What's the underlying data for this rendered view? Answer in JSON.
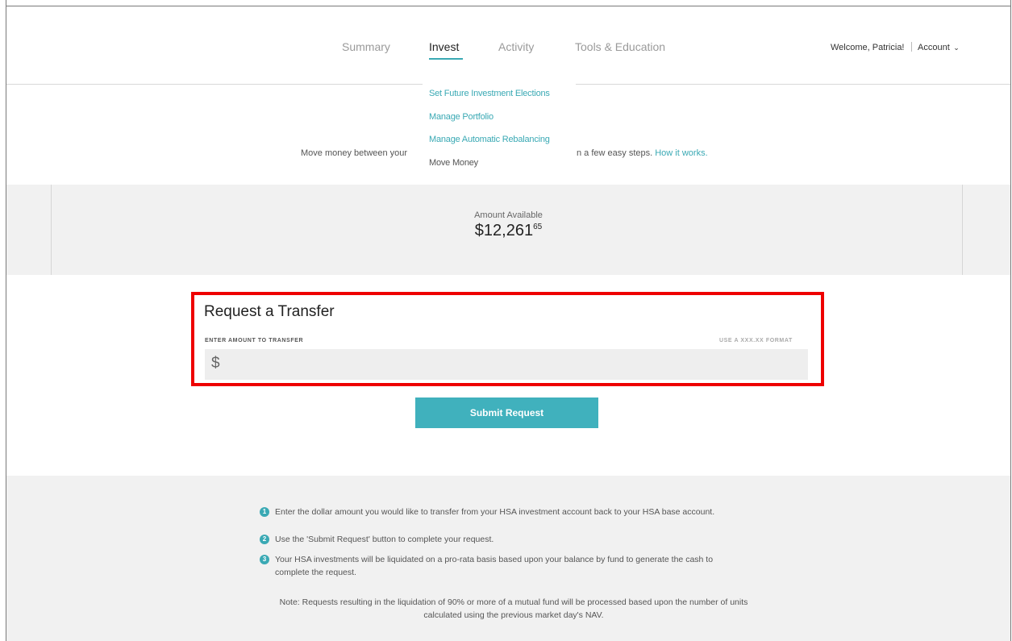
{
  "nav": {
    "items": [
      {
        "label": "Summary"
      },
      {
        "label": "Invest"
      },
      {
        "label": "Activity"
      },
      {
        "label": "Tools & Education"
      }
    ],
    "welcome": "Welcome, Patricia!",
    "account": "Account",
    "accent": "#3aa9b4"
  },
  "dropdown": {
    "items": [
      {
        "label": "Set Future Investment Elections"
      },
      {
        "label": "Manage Portfolio"
      },
      {
        "label": "Manage Automatic Rebalancing"
      },
      {
        "label": "Move Money"
      }
    ]
  },
  "intro": {
    "left": "Move money between your",
    "right": "n a few easy steps.",
    "link": "How it works."
  },
  "amount": {
    "label": "Amount Available",
    "dollars": "$12,261",
    "cents": "65"
  },
  "transfer": {
    "title": "Request a Transfer",
    "field_label": "ENTER AMOUNT TO TRANSFER",
    "format_hint": "USE A XXX.XX FORMAT",
    "currency": "$",
    "value": "",
    "placeholder": ""
  },
  "submit_label": "Submit Request",
  "steps": [
    {
      "num": "1",
      "text": "Enter the dollar amount you would like to transfer from your HSA investment account back to your HSA base account."
    },
    {
      "num": "2",
      "text": "Use the 'Submit Request' button to complete your request."
    },
    {
      "num": "3",
      "text": "Your HSA investments will be liquidated on a pro-rata basis based upon your balance by fund to generate the cash to complete the request."
    }
  ],
  "note": "Note: Requests resulting in the liquidation of 90% or more of a mutual fund will be processed based upon the number of units calculated using the previous market day's NAV."
}
